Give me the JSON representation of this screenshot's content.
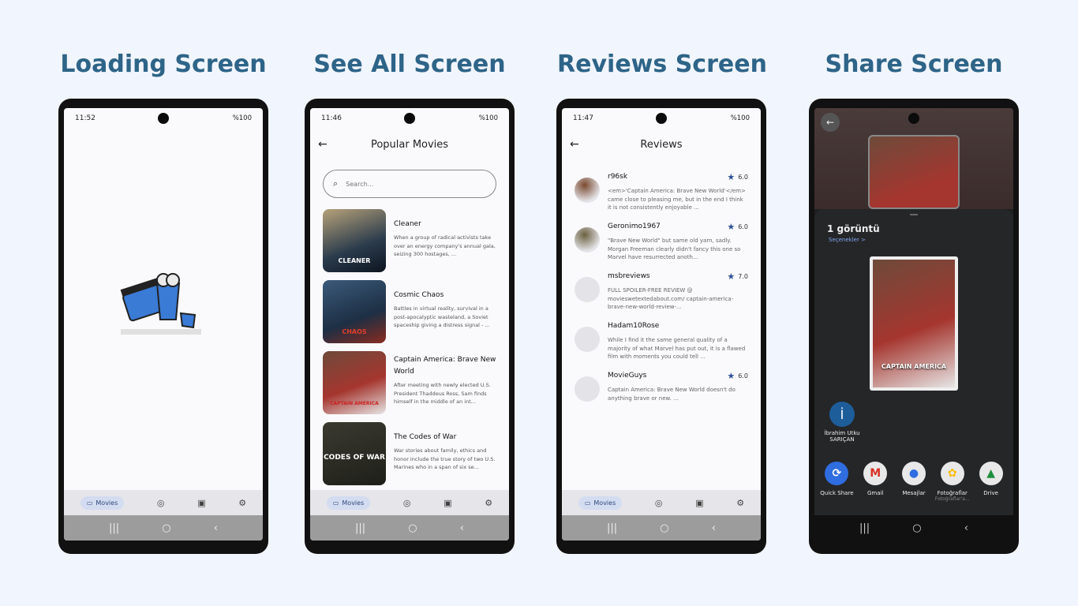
{
  "titles": [
    "Loading Screen",
    "See All Screen",
    "Reviews Screen",
    "Share Screen"
  ],
  "colors": {
    "title": "#2e6488",
    "accent": "#3a7bd5",
    "star": "#2e4f95"
  },
  "status": {
    "loading": {
      "time": "11:52",
      "right": "%100"
    },
    "seeall": {
      "time": "11:46",
      "right": "%100"
    },
    "reviews": {
      "time": "11:47",
      "right": "%100"
    }
  },
  "bottom_nav": {
    "active": "Movies"
  },
  "seeall": {
    "title": "Popular Movies",
    "search_placeholder": "Search...",
    "movies": [
      {
        "title": "Cleaner",
        "desc": "When a group of radical activists take over an energy company's annual gala, seizing 300 hostages, ...",
        "poster": "CLEANER"
      },
      {
        "title": "Cosmic Chaos",
        "desc": "Battles in virtual reality, survival in a post-apocalyptic wasteland, a Soviet spaceship giving a distress signal - ...",
        "poster": "CHAOS"
      },
      {
        "title": "Captain America: Brave New World",
        "desc": "After meeting with newly elected U.S. President Thaddeus Ross, Sam finds himself in the middle of an int...",
        "poster": "CAPTAIN AMERICA"
      },
      {
        "title": "The Codes of War",
        "desc": "War stories about family, ethics and honor include the true story of two U.S. Marines who in a span of six se...",
        "poster": "CODES OF WAR"
      }
    ]
  },
  "reviews": {
    "title": "Reviews",
    "items": [
      {
        "author": "r96sk",
        "rating": "6.0",
        "text": "<em>'Captain America: Brave New World'</em> came close to pleasing me, but in the end I think it is not consistently enjoyable ..."
      },
      {
        "author": "Geronimo1967",
        "rating": "6.0",
        "text": "\"Brave New World\" but same old yarn, sadly. Morgan Freeman clearly didn't fancy this one so Marvel have resurrected anoth..."
      },
      {
        "author": "msbreviews",
        "rating": "7.0",
        "text": "FULL SPOILER-FREE REVIEW @ movieswetextedabout.com/ captain-america-brave-new-world-review-..."
      },
      {
        "author": "Hadam10Rose",
        "rating": "",
        "text": "While I find it the same general quality of a majority of what Marvel has put out, it is a flawed film with moments you could tell ..."
      },
      {
        "author": "MovieGuys",
        "rating": "6.0",
        "text": "Captain America: Brave New World doesn't do anything brave or new. ..."
      }
    ]
  },
  "share": {
    "title": "1 görüntü",
    "options": "Seçenekler >",
    "preview_text": "CAPTAIN AMERICA",
    "contact": {
      "initial": "İ",
      "name": "İbrahim Utku SARIÇAN"
    },
    "apps": [
      {
        "name": "Quick Share",
        "sub": "",
        "icon": "⟳",
        "color": "#2f6de1"
      },
      {
        "name": "Gmail",
        "sub": "",
        "icon": "M",
        "color": "#d93025"
      },
      {
        "name": "Mesajlar",
        "sub": "",
        "icon": "💬",
        "color": "#2f6de1"
      },
      {
        "name": "Fotoğraflar",
        "sub": "Fotoğraflar'a...",
        "icon": "✿",
        "color": "#fbbc04"
      },
      {
        "name": "Drive",
        "sub": "",
        "icon": "▲",
        "color": "#1e8e3e"
      }
    ]
  }
}
